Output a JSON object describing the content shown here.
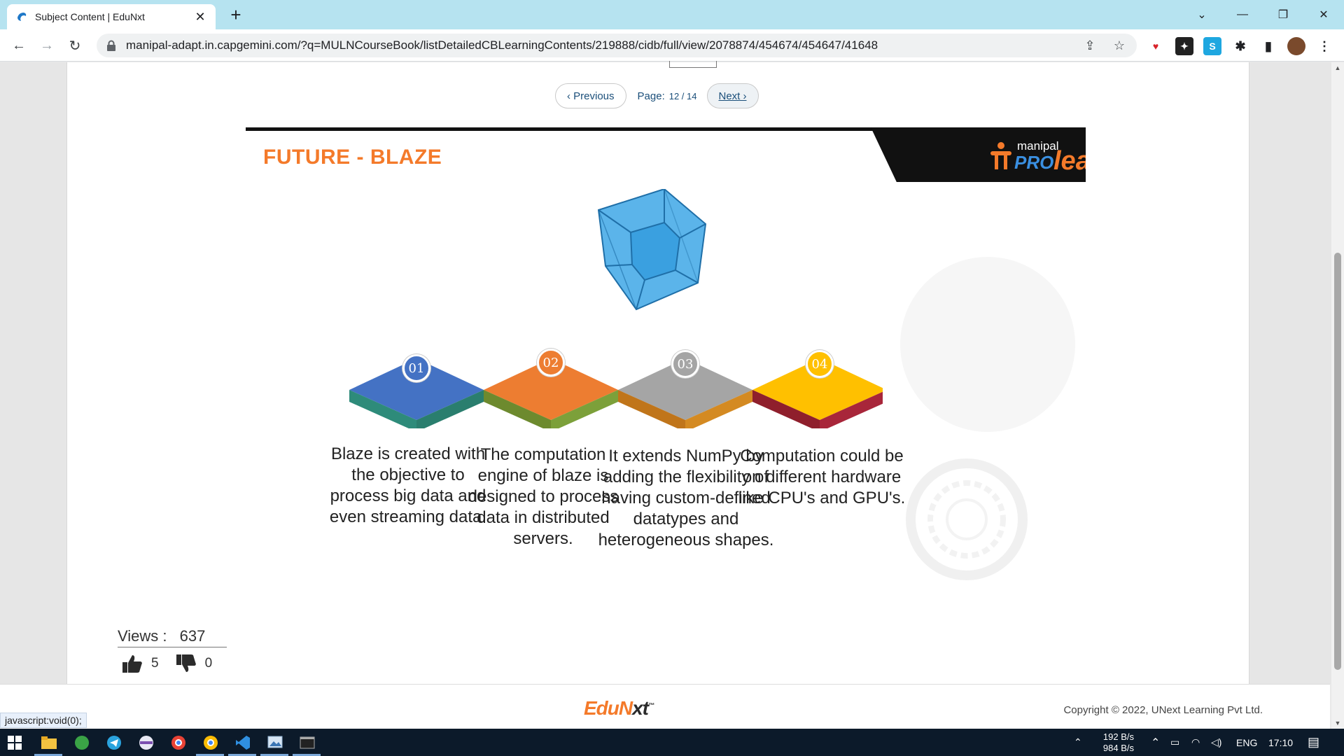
{
  "browser": {
    "tab_title": "Subject Content | EduNxt",
    "url": "manipal-adapt.in.capgemini.com/?q=MULNCourseBook/listDetailedCBLearningContents/219888/cidb/full/view/2078874/454674/454647/41648",
    "new_tab_symbol": "+",
    "close_symbol": "✕"
  },
  "pager": {
    "prev_label": "‹ Previous",
    "page_label": "Page:",
    "page_value": "12 / 14",
    "next_label": "Next ›"
  },
  "slide": {
    "title": "FUTURE - BLAZE",
    "brand_small": "manipal",
    "brand_pro": "PRO",
    "brand_learn": "learn",
    "steps": [
      {
        "num": "01",
        "color": "#4472c4",
        "text": "Blaze is created with the objective to process big data and even streaming data."
      },
      {
        "num": "02",
        "color": "#ed7d31",
        "text": "The computation engine of blaze is designed to process data in distributed servers."
      },
      {
        "num": "03",
        "color": "#a5a5a5",
        "text": "It extends NumPy by adding the flexibility of having custom-defined datatypes and heterogeneous shapes."
      },
      {
        "num": "04",
        "color": "#ffc000",
        "text": "Computation could be on different hardware like CPU's and GPU's."
      }
    ]
  },
  "stats": {
    "views_label": "Views :",
    "views_value": "637",
    "likes": "5",
    "dislikes": "0"
  },
  "footer": {
    "logo_a": "EduN",
    "logo_b": "xt",
    "logo_tm": "™",
    "copyright": "Copyright © 2022, UNext Learning Pvt Ltd.",
    "status_link": "javascript:void(0);"
  },
  "taskbar": {
    "net_up": "192 B/s",
    "net_down": "984 B/s",
    "lang": "ENG",
    "time": "17:10"
  },
  "colors": {
    "accent_orange": "#f47a2a",
    "link_blue": "#1b4f7a",
    "tab_strip": "#b6e3f0"
  }
}
